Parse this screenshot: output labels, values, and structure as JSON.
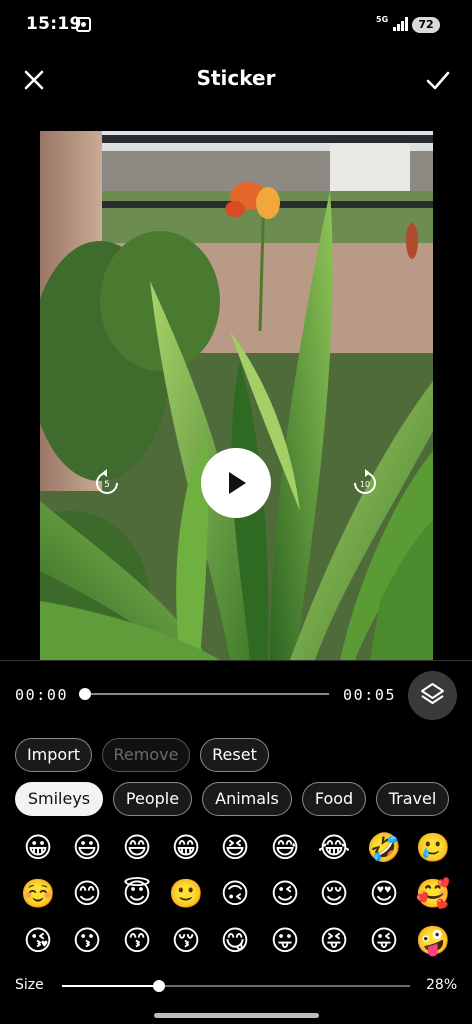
{
  "status_bar": {
    "time": "15:19",
    "network": "5G",
    "battery": "72",
    "icons": [
      "screen-record-icon",
      "signal-icon"
    ]
  },
  "app_bar": {
    "title": "Sticker",
    "close_icon": "close-icon",
    "confirm_icon": "check-icon"
  },
  "player": {
    "current_time": "00:00",
    "duration": "00:05",
    "progress": 0,
    "rewind_seconds": "5",
    "forward_seconds": "10",
    "layers_icon": "layers-icon"
  },
  "actions": {
    "import": "Import",
    "remove": "Remove",
    "reset": "Reset"
  },
  "categories": [
    "Smileys",
    "People",
    "Animals",
    "Food",
    "Travel"
  ],
  "selected_category": "Smileys",
  "emojis": [
    [
      "😀",
      "😃",
      "😄",
      "😁",
      "😆",
      "😅",
      "😂",
      "🤣",
      "🥲"
    ],
    [
      "☺️",
      "😊",
      "😇",
      "🙂",
      "🙃",
      "😉",
      "😌",
      "😍",
      "🥰"
    ],
    [
      "😘",
      "😗",
      "😙",
      "😚",
      "😋",
      "😛",
      "😝",
      "😜",
      "🤪"
    ]
  ],
  "size": {
    "label": "Size",
    "value": "28%",
    "fraction": 0.28
  },
  "colors": {
    "background": "#000000",
    "chip_border": "#8a8a8a",
    "chip_selected": "#f3f3f3"
  }
}
